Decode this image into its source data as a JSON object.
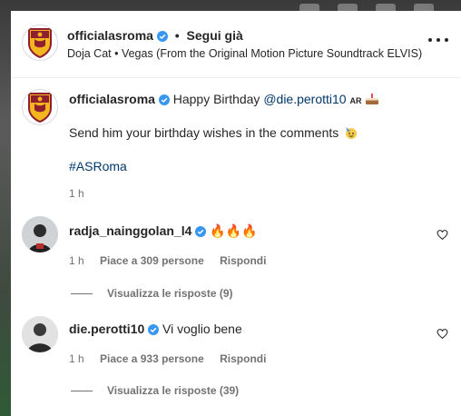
{
  "header": {
    "username": "officialasroma",
    "separator": "•",
    "follow_label": "Segui già",
    "song": "Doja Cat • Vegas (From the Original Motion Picture Soundtrack ELVIS)"
  },
  "caption": {
    "username": "officialasroma",
    "line1_text": "Happy Birthday",
    "mention": "@die.perotti10",
    "ar_badge": "AR",
    "line2": "Send him your birthday wishes in the comments",
    "hashtag": "#ASRoma",
    "time": "1 h"
  },
  "comments": [
    {
      "username": "radja_nainggolan_l4",
      "text": "🔥🔥🔥",
      "time": "1 h",
      "likes": "Piace a 309 persone",
      "reply": "Rispondi",
      "view_replies": "Visualizza le risposte (9)"
    },
    {
      "username": "die.perotti10",
      "text": "Vi voglio bene",
      "time": "1 h",
      "likes": "Piace a 933 persone",
      "reply": "Rispondi",
      "view_replies": "Visualizza le risposte (39)"
    }
  ],
  "colors": {
    "verified": "#3897f0",
    "link": "#00376b",
    "muted": "#737373",
    "text": "#262626"
  },
  "icons": {
    "verified": "verified-badge-icon",
    "more": "more-options-icon",
    "like": "heart-icon",
    "cake": "cake-emoji",
    "party": "party-face-emoji"
  }
}
